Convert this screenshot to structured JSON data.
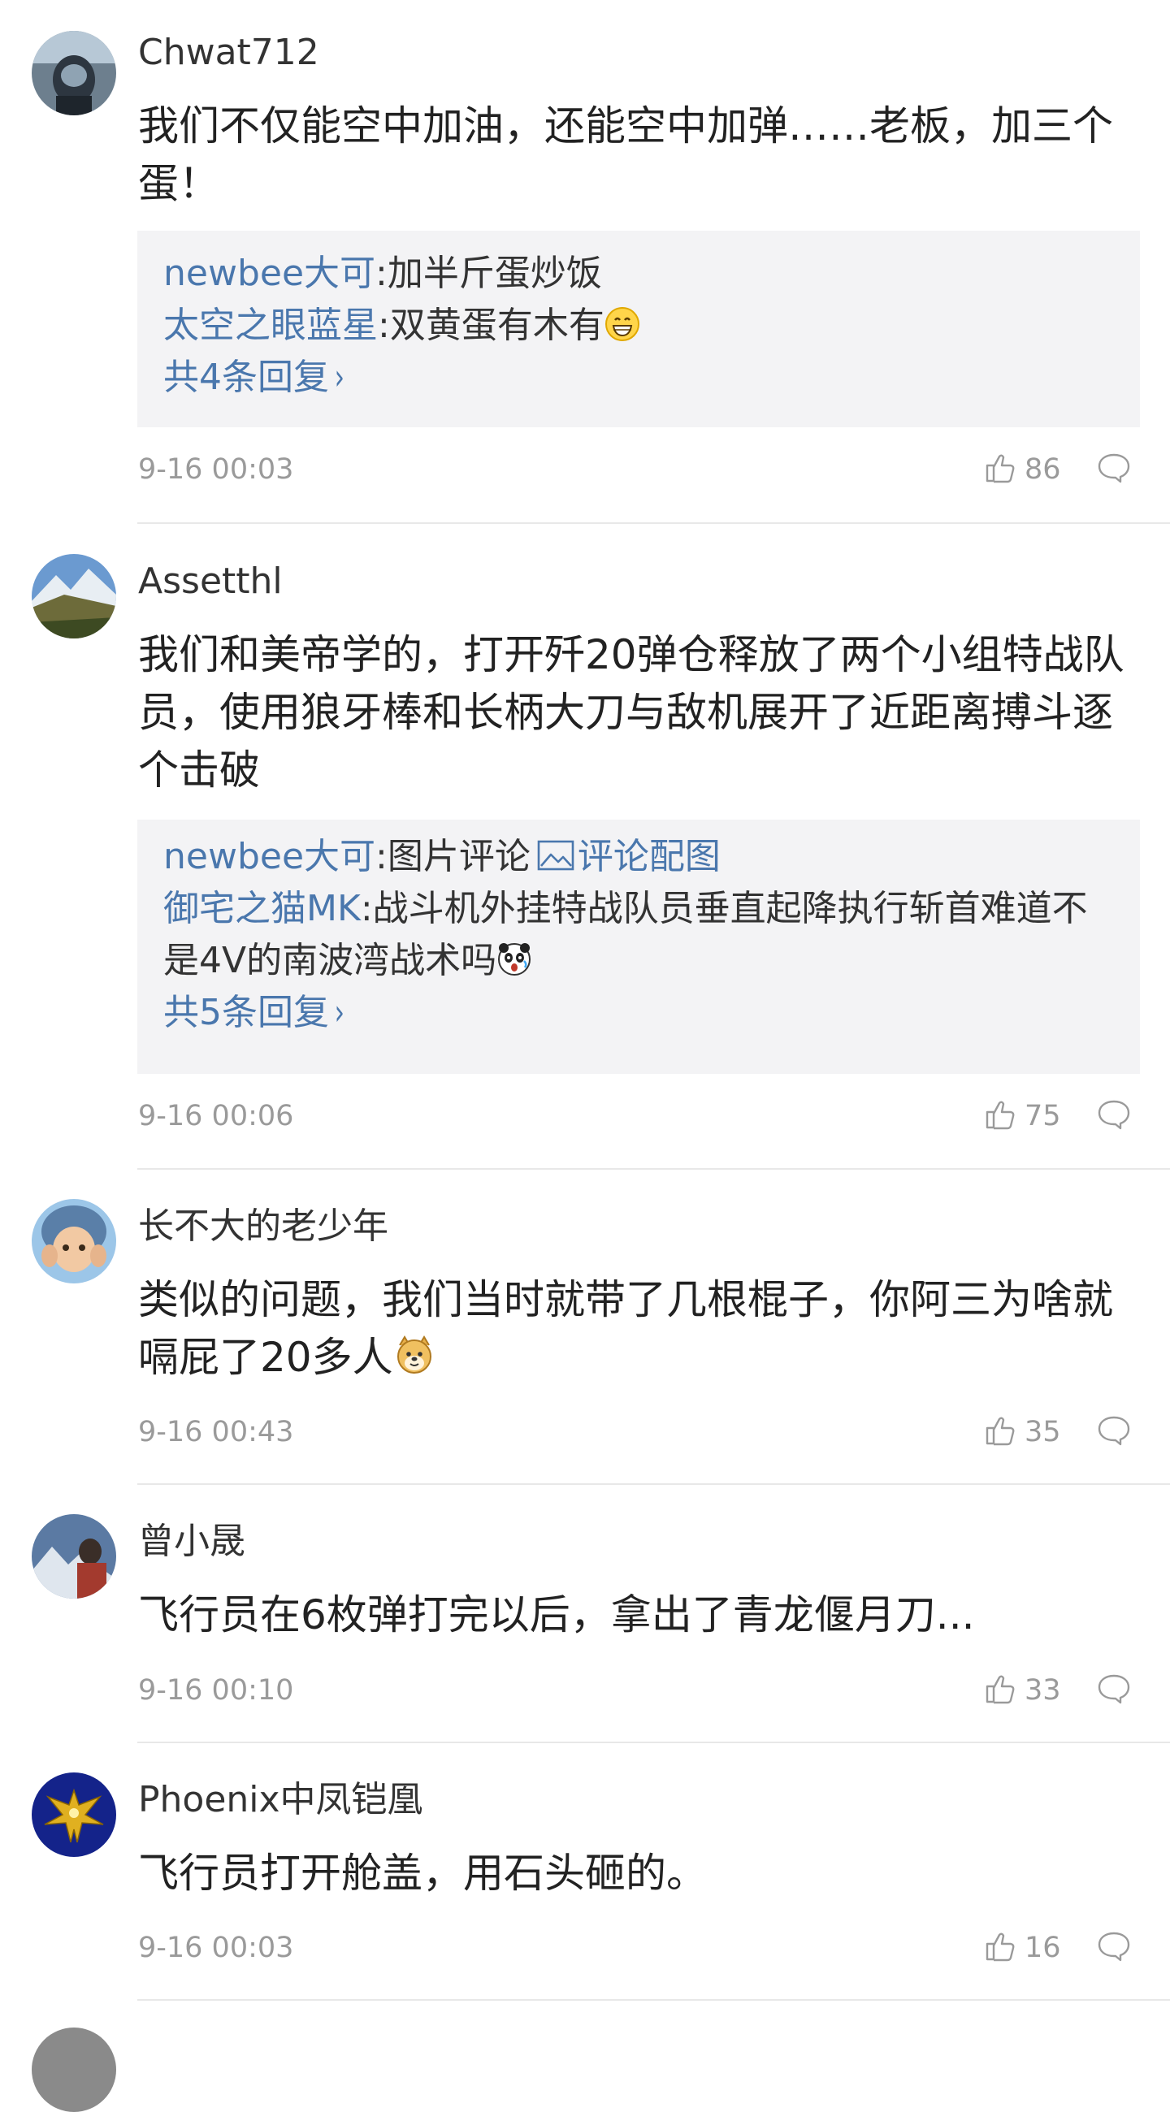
{
  "comments": [
    {
      "user": "Chwat712",
      "text": "我们不仅能空中加油，还能空中加弹……老板，加三个蛋！",
      "replies": [
        {
          "user": "newbee大可",
          "text": ":加半斤蛋炒饭"
        },
        {
          "user": "太空之眼蓝星",
          "text": ":双黄蛋有木有",
          "emoji": "grin-emoji"
        }
      ],
      "reply_total": "共4条回复",
      "time": "9-16 00:03",
      "likes": "86"
    },
    {
      "user": "Assetthl",
      "text": "我们和美帝学的，打开歼20弹仓释放了两个小组特战队员，使用狼牙棒和长柄大刀与敌机展开了近距离搏斗逐个击破",
      "replies": [
        {
          "user": "newbee大可",
          "text": ":图片评论",
          "image_link": "评论配图",
          "icon": "image-icon"
        },
        {
          "user": "御宅之猫MK",
          "text": ":战斗机外挂特战队员垂直起降执行斩首难道不是4V的南波湾战术吗",
          "emoji": "shocked-panda-emoji"
        }
      ],
      "reply_total": "共5条回复",
      "time": "9-16 00:06",
      "likes": "75"
    },
    {
      "user": "长不大的老少年",
      "text": "类似的问题，我们当时就带了几根棍子，你阿三为啥就嗝屁了20多人",
      "emoji": "doge-emoji",
      "time": "9-16 00:43",
      "likes": "35"
    },
    {
      "user": "曾小晟",
      "text": "飞行员在6枚弹打完以后，拿出了青龙偃月刀...",
      "time": "9-16 00:10",
      "likes": "33"
    },
    {
      "user": "Phoenix中凤铠凰",
      "text": "飞行员打开舱盖，用石头砸的。",
      "time": "9-16 00:03",
      "likes": "16"
    }
  ],
  "icons": {
    "like": "thumbs-up-icon",
    "reply": "speech-bubble-icon",
    "chevron": "chevron-right-icon"
  },
  "colors": {
    "link": "#4a77ad",
    "reply_bg": "#f3f3f5",
    "meta": "#9a9a9a"
  }
}
